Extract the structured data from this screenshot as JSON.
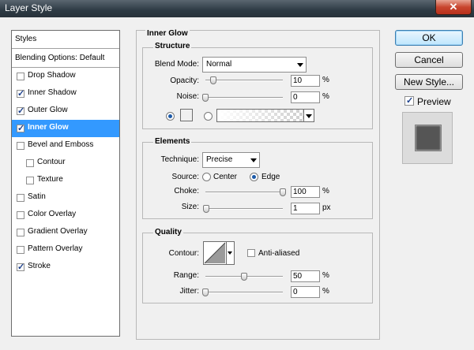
{
  "window": {
    "title": "Layer Style",
    "close_glyph": "✕"
  },
  "styles_list": {
    "header": "Styles",
    "blending": "Blending Options: Default",
    "items": [
      {
        "label": "Drop Shadow",
        "checked": false,
        "indent": false,
        "selected": false
      },
      {
        "label": "Inner Shadow",
        "checked": true,
        "indent": false,
        "selected": false
      },
      {
        "label": "Outer Glow",
        "checked": true,
        "indent": false,
        "selected": false
      },
      {
        "label": "Inner Glow",
        "checked": true,
        "indent": false,
        "selected": true
      },
      {
        "label": "Bevel and Emboss",
        "checked": false,
        "indent": false,
        "selected": false
      },
      {
        "label": "Contour",
        "checked": false,
        "indent": true,
        "selected": false
      },
      {
        "label": "Texture",
        "checked": false,
        "indent": true,
        "selected": false
      },
      {
        "label": "Satin",
        "checked": false,
        "indent": false,
        "selected": false
      },
      {
        "label": "Color Overlay",
        "checked": false,
        "indent": false,
        "selected": false
      },
      {
        "label": "Gradient Overlay",
        "checked": false,
        "indent": false,
        "selected": false
      },
      {
        "label": "Pattern Overlay",
        "checked": false,
        "indent": false,
        "selected": false
      },
      {
        "label": "Stroke",
        "checked": true,
        "indent": false,
        "selected": false
      }
    ]
  },
  "panel": {
    "title": "Inner Glow",
    "structure": {
      "title": "Structure",
      "blend_mode_label": "Blend Mode:",
      "blend_mode_value": "Normal",
      "opacity_label": "Opacity:",
      "opacity_value": "10",
      "opacity_level": 10,
      "noise_label": "Noise:",
      "noise_value": "0",
      "noise_level": 0,
      "percent": "%"
    },
    "elements": {
      "title": "Elements",
      "technique_label": "Technique:",
      "technique_value": "Precise",
      "source_label": "Source:",
      "source_center": "Center",
      "source_edge": "Edge",
      "choke_label": "Choke:",
      "choke_value": "100",
      "choke_level": 100,
      "size_label": "Size:",
      "size_value": "1",
      "size_level": 1,
      "percent": "%",
      "px": "px"
    },
    "quality": {
      "title": "Quality",
      "contour_label": "Contour:",
      "anti_aliased_label": "Anti-aliased",
      "range_label": "Range:",
      "range_value": "50",
      "range_level": 50,
      "jitter_label": "Jitter:",
      "jitter_value": "0",
      "jitter_level": 0,
      "percent": "%"
    }
  },
  "buttons": {
    "ok": "OK",
    "cancel": "Cancel",
    "new_style": "New Style...",
    "preview_label": "Preview"
  },
  "colors": {
    "selection": "#3399ff",
    "glow_swatch": "#ffffff",
    "preview_square": "#555555"
  }
}
